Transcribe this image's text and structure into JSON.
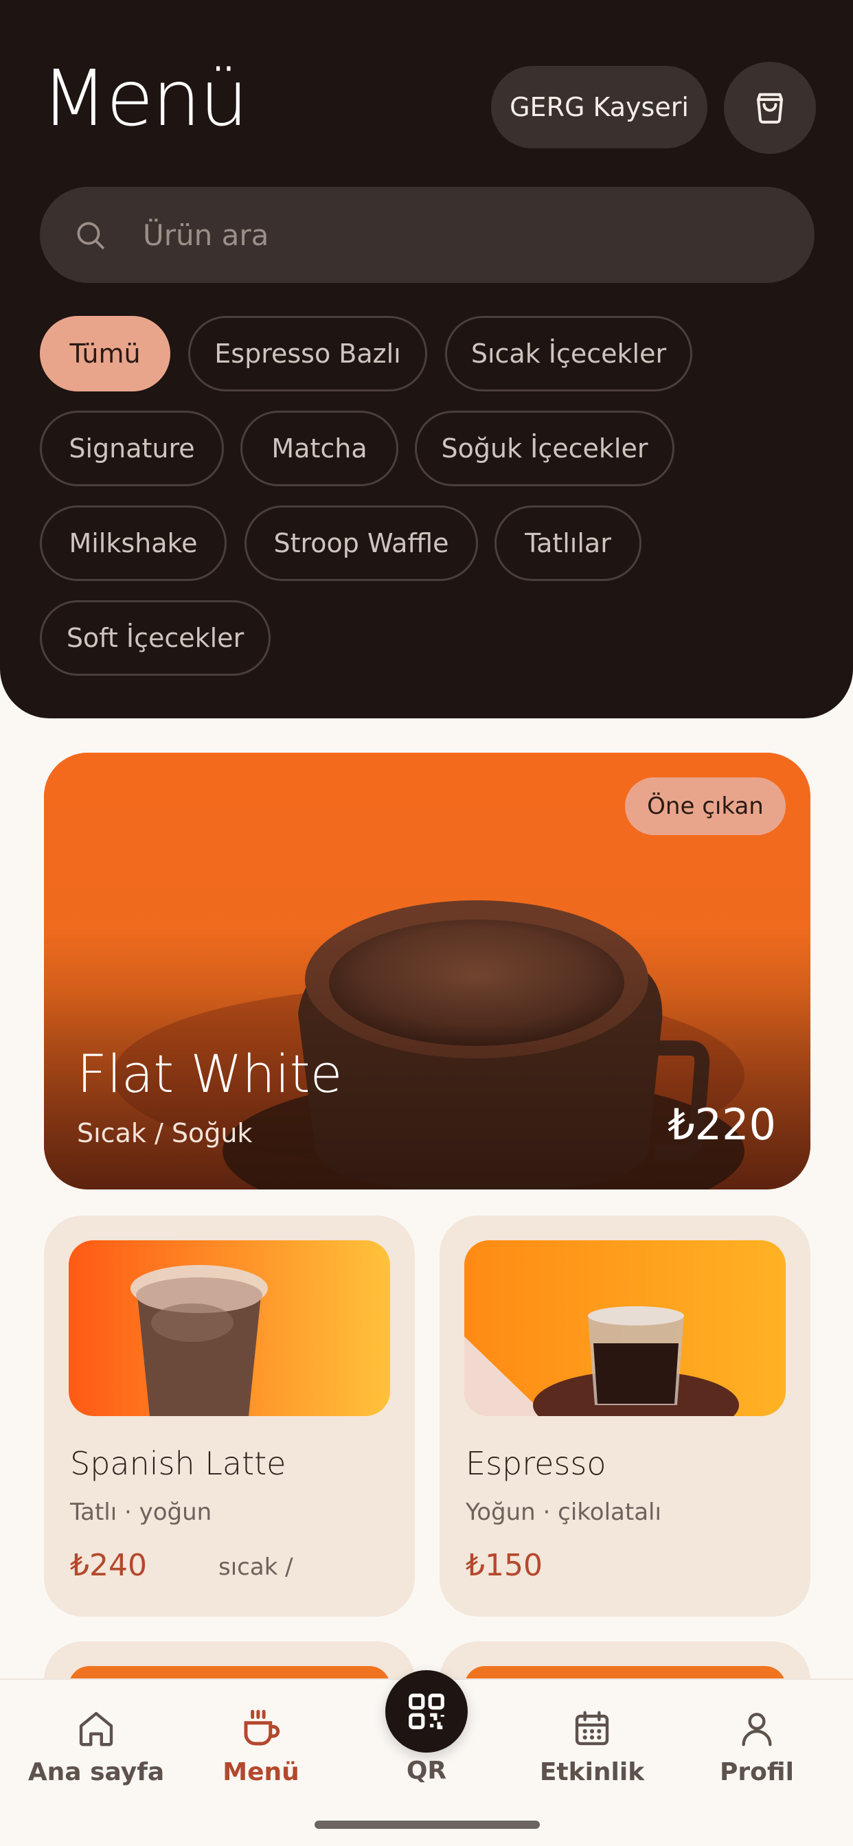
{
  "header": {
    "title": "Menü",
    "location": "GERG Kayseri",
    "search_placeholder": "Ürün ara"
  },
  "categories": [
    {
      "label": "Tümü",
      "active": true
    },
    {
      "label": "Espresso Bazlı"
    },
    {
      "label": "Sıcak İçecekler"
    },
    {
      "label": "Signature"
    },
    {
      "label": "Matcha"
    },
    {
      "label": "Soğuk İçecekler"
    },
    {
      "label": "Milkshake"
    },
    {
      "label": "Stroop Waffle"
    },
    {
      "label": "Tatlılar"
    },
    {
      "label": "Soft İçecekler"
    }
  ],
  "featured": {
    "badge": "Öne çıkan",
    "name": "Flat White",
    "subtitle": "Sıcak / Soğuk",
    "price": "₺220"
  },
  "products": [
    {
      "name": "Spanish Latte",
      "desc": "Tatlı · yoğun",
      "price": "₺240",
      "note": "sıcak /"
    },
    {
      "name": "Espresso",
      "desc": "Yoğun · çikolatalı",
      "price": "₺150"
    }
  ],
  "nav": {
    "home": "Ana sayfa",
    "menu": "Menü",
    "qr": "QR",
    "events": "Etkinlik",
    "profile": "Profil"
  },
  "colors": {
    "header_bg": "#1E1412",
    "accent": "#E9A58C",
    "price": "#B4482C",
    "card_bg": "#F3E6DA"
  }
}
